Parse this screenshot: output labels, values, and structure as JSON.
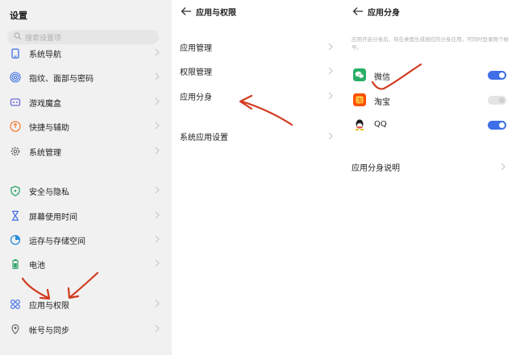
{
  "settings": {
    "title": "设置",
    "search_placeholder": "搜索设置项",
    "items": [
      {
        "label": "系统导航",
        "icon": "navigation-icon"
      },
      {
        "label": "指纹、面部与密码",
        "icon": "fingerprint-icon"
      },
      {
        "label": "游戏魔盒",
        "icon": "gamebox-icon"
      },
      {
        "label": "快捷与辅助",
        "icon": "shortcut-icon"
      },
      {
        "label": "系统管理",
        "icon": "gear-icon"
      },
      {
        "label": "安全与隐私",
        "icon": "shield-icon"
      },
      {
        "label": "屏幕使用时间",
        "icon": "hourglass-icon"
      },
      {
        "label": "运存与存储空间",
        "icon": "storage-icon"
      },
      {
        "label": "电池",
        "icon": "battery-icon"
      },
      {
        "label": "应用与权限",
        "icon": "apps-icon"
      },
      {
        "label": "帐号与同步",
        "icon": "account-icon"
      }
    ]
  },
  "apps_permissions": {
    "title": "应用与权限",
    "items": [
      {
        "label": "应用管理"
      },
      {
        "label": "权限管理"
      },
      {
        "label": "应用分身"
      },
      {
        "label": "系统应用设置"
      }
    ]
  },
  "app_clone": {
    "title": "应用分身",
    "description": "应用开启分身后，将在桌面生成相应的分身应用，可同时登录两个帐号。",
    "apps": [
      {
        "name": "微信",
        "icon": "wechat-icon",
        "enabled": true
      },
      {
        "name": "淘宝",
        "icon": "taobao-icon",
        "enabled": false
      },
      {
        "name": "QQ",
        "icon": "qq-icon",
        "enabled": true
      }
    ],
    "help_label": "应用分身说明"
  },
  "colors": {
    "accent": "#3e6ee8",
    "annotation": "#d13a1e",
    "wechat": "#2aae67",
    "taobao": "#ff5000"
  }
}
